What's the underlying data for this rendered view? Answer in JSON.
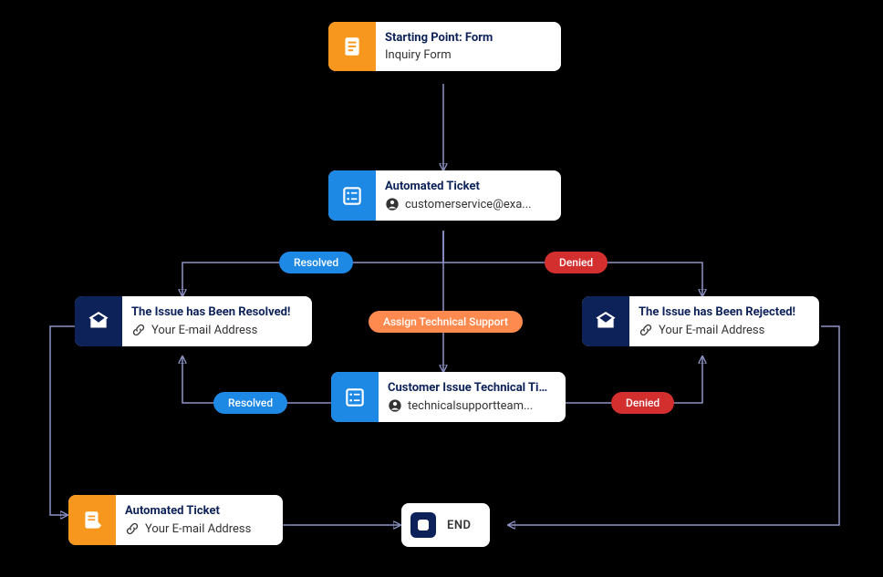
{
  "colors": {
    "orange": "#f8971d",
    "blue": "#1e88e5",
    "navy": "#0d2259",
    "red": "#d32f2f",
    "peach": "#ff8a50",
    "connector": "#8e94c8"
  },
  "nodes": {
    "start": {
      "title": "Starting Point: Form",
      "subtitle": "Inquiry Form",
      "icon": "form",
      "color": "orange"
    },
    "ticket1": {
      "title": "Automated Ticket",
      "subtitle": "customerservice@exa...",
      "icon": "list",
      "sub_icon": "person",
      "color": "blue"
    },
    "resolved": {
      "title": "The Issue has Been Resolved!",
      "subtitle": "Your E-mail Address",
      "icon": "envelope",
      "sub_icon": "link",
      "color": "navy"
    },
    "rejected": {
      "title": "The Issue has Been Rejected!",
      "subtitle": "Your E-mail Address",
      "icon": "envelope",
      "sub_icon": "link",
      "color": "navy"
    },
    "tech_ticket": {
      "title": "Customer Issue Technical Tic...",
      "subtitle": "technicalsupportteam...",
      "icon": "list",
      "sub_icon": "person",
      "color": "blue"
    },
    "auto_ticket": {
      "title": "Automated Ticket",
      "subtitle": "Your E-mail Address",
      "icon": "form-arrow",
      "sub_icon": "link",
      "color": "orange"
    },
    "end": {
      "label": "END"
    }
  },
  "pills": {
    "resolved1": "Resolved",
    "denied1": "Denied",
    "assign": "Assign Technical Support",
    "resolved2": "Resolved",
    "denied2": "Denied"
  }
}
